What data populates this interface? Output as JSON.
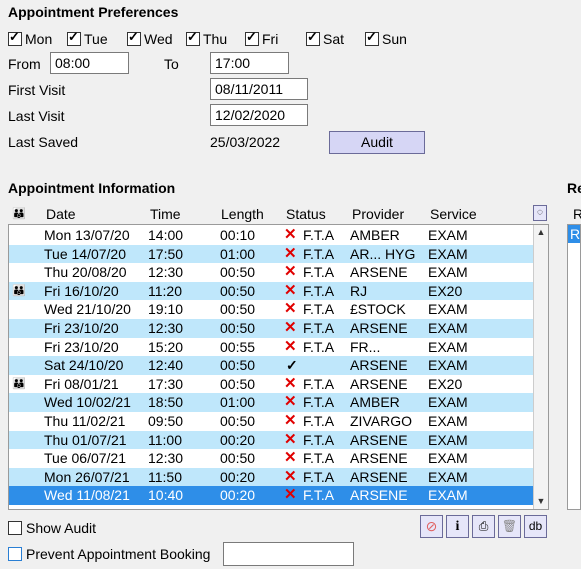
{
  "prefs": {
    "title": "Appointment Preferences",
    "days": [
      {
        "label": "Mon",
        "checked": true
      },
      {
        "label": "Tue",
        "checked": true
      },
      {
        "label": "Wed",
        "checked": true
      },
      {
        "label": "Thu",
        "checked": true
      },
      {
        "label": "Fri",
        "checked": true
      },
      {
        "label": "Sat",
        "checked": true
      },
      {
        "label": "Sun",
        "checked": true
      }
    ],
    "from_label": "From",
    "from_value": "08:00",
    "to_label": "To",
    "to_value": "17:00",
    "first_visit_label": "First Visit",
    "first_visit_value": "08/11/2011",
    "last_visit_label": "Last Visit",
    "last_visit_value": "12/02/2020",
    "last_saved_label": "Last Saved",
    "last_saved_value": "25/03/2022",
    "audit_button": "Audit"
  },
  "appointments": {
    "title": "Appointment Information",
    "headers": {
      "date": "Date",
      "time": "Time",
      "length": "Length",
      "status": "Status",
      "provider": "Provider",
      "service": "Service"
    },
    "rows": [
      {
        "people": false,
        "date": "Mon 13/07/20",
        "time": "14:00",
        "length": "00:10",
        "status_icon": "x",
        "status": "F.T.A",
        "provider": "AMBER",
        "service": "EXAM"
      },
      {
        "people": false,
        "date": "Tue 14/07/20",
        "time": "17:50",
        "length": "01:00",
        "status_icon": "x",
        "status": "F.T.A",
        "provider": "AR...  HYG",
        "service": "EXAM"
      },
      {
        "people": false,
        "date": "Thu 20/08/20",
        "time": "12:30",
        "length": "00:50",
        "status_icon": "x",
        "status": "F.T.A",
        "provider": "ARSENE",
        "service": "EXAM"
      },
      {
        "people": true,
        "date": "Fri 16/10/20",
        "time": "11:20",
        "length": "00:50",
        "status_icon": "x",
        "status": "F.T.A",
        "provider": "RJ",
        "service": "EX20"
      },
      {
        "people": false,
        "date": "Wed 21/10/20",
        "time": "19:10",
        "length": "00:50",
        "status_icon": "x",
        "status": "F.T.A",
        "provider": "£STOCK",
        "service": "EXAM"
      },
      {
        "people": false,
        "date": "Fri 23/10/20",
        "time": "12:30",
        "length": "00:50",
        "status_icon": "x",
        "status": "F.T.A",
        "provider": "ARSENE",
        "service": "EXAM"
      },
      {
        "people": false,
        "date": "Fri 23/10/20",
        "time": "15:20",
        "length": "00:55",
        "status_icon": "x",
        "status": "F.T.A",
        "provider": "FR...",
        "service": "EXAM"
      },
      {
        "people": false,
        "date": "Sat 24/10/20",
        "time": "12:40",
        "length": "00:50",
        "status_icon": "tick",
        "status": "",
        "provider": "ARSENE",
        "service": "EXAM"
      },
      {
        "people": true,
        "date": "Fri 08/01/21",
        "time": "17:30",
        "length": "00:50",
        "status_icon": "x",
        "status": "F.T.A",
        "provider": "ARSENE",
        "service": "EX20"
      },
      {
        "people": false,
        "date": "Wed 10/02/21",
        "time": "18:50",
        "length": "01:00",
        "status_icon": "x",
        "status": "F.T.A",
        "provider": "AMBER",
        "service": "EXAM"
      },
      {
        "people": false,
        "date": "Thu 11/02/21",
        "time": "09:50",
        "length": "00:50",
        "status_icon": "x",
        "status": "F.T.A",
        "provider": "ZIVARGO",
        "service": "EXAM"
      },
      {
        "people": false,
        "date": "Thu 01/07/21",
        "time": "11:00",
        "length": "00:20",
        "status_icon": "x",
        "status": "F.T.A",
        "provider": "ARSENE",
        "service": "EXAM"
      },
      {
        "people": false,
        "date": "Tue 06/07/21",
        "time": "12:30",
        "length": "00:50",
        "status_icon": "x",
        "status": "F.T.A",
        "provider": "ARSENE",
        "service": "EXAM"
      },
      {
        "people": false,
        "date": "Mon 26/07/21",
        "time": "11:50",
        "length": "00:20",
        "status_icon": "x",
        "status": "F.T.A",
        "provider": "ARSENE",
        "service": "EXAM"
      },
      {
        "people": false,
        "date": "Wed 11/08/21",
        "time": "10:40",
        "length": "00:20",
        "status_icon": "x",
        "status": "F.T.A",
        "provider": "ARSENE",
        "service": "EXAM"
      }
    ],
    "selected_index": 14
  },
  "footer": {
    "show_audit_label": "Show Audit",
    "prevent_booking_label": "Prevent Appointment Booking",
    "prevent_value": "",
    "db_button": "db",
    "info_button": "i"
  },
  "right_panel": {
    "title": "Re",
    "col": "R",
    "selected": "R"
  },
  "colors": {
    "alt_row": "#bfe7fb",
    "selected_row": "#2e8ee8",
    "fta_icon": "#e00000",
    "button_bg": "#d6d6f5"
  }
}
